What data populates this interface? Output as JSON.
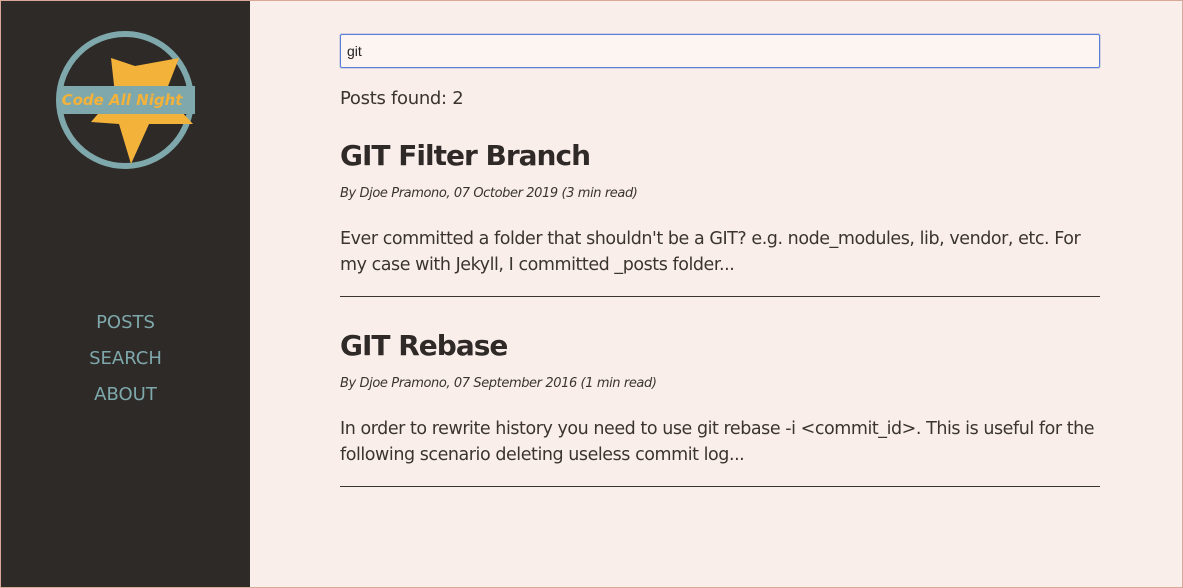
{
  "site": {
    "logo_text": "Code All Night",
    "logo_icon": "star-circle-logo",
    "colors": {
      "sidebar_bg": "#2e2a28",
      "page_bg": "#faeeea",
      "accent_teal": "#7ea8ab",
      "accent_gold": "#f3b23a"
    }
  },
  "nav": {
    "posts": "POSTS",
    "search": "SEARCH",
    "about": "ABOUT"
  },
  "search": {
    "value": "git",
    "posts_found": "Posts found: 2"
  },
  "posts": [
    {
      "title": "GIT Filter Branch",
      "meta": "By Djoe Pramono, 07 October 2019 (3 min read)",
      "excerpt": "Ever committed a folder that shouldn't be a GIT? e.g. node_modules, lib, vendor, etc. For my case with Jekyll, I committed _posts folder..."
    },
    {
      "title": "GIT Rebase",
      "meta": "By Djoe Pramono, 07 September 2016 (1 min read)",
      "excerpt": "In order to rewrite history you need to use git rebase -i <commit_id>. This is useful for the following scenario deleting useless commit log..."
    }
  ]
}
